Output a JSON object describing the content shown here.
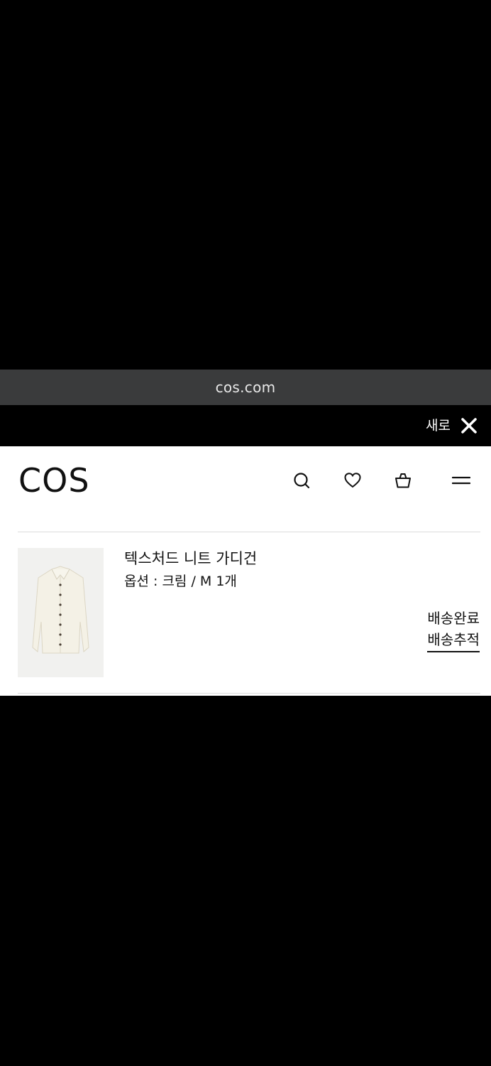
{
  "browser": {
    "url": "cos.com",
    "refresh_label": "새로고침"
  },
  "header": {
    "logo": "COS",
    "icons": [
      "search-icon",
      "heart-icon",
      "bag-icon",
      "menu-icon"
    ]
  },
  "order_item": {
    "name": "텍스처드 니트 가디건",
    "option": "옵션 : 크림 / M 1개",
    "status": "배송완료",
    "track_label": "배송추적",
    "image_color": "#f4f1e6"
  },
  "colors": {
    "url_bar": "#3a3b3c",
    "text": "#111111",
    "divider": "#dcdcdc"
  }
}
